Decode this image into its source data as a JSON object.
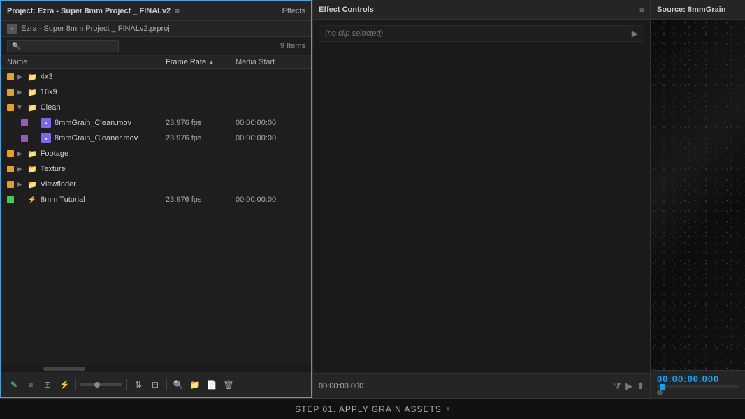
{
  "left_panel": {
    "title": "Project: Ezra - Super 8mm Project _ FINALv2",
    "menu_icon": "≡",
    "tabs": [
      {
        "label": "Effects",
        "active": false
      }
    ],
    "project_path": "Ezra - Super 8mm Project _ FINALv2.prproj",
    "search_placeholder": "",
    "items_count": "9 Items",
    "columns": {
      "name": "Name",
      "frame_rate": "Frame Rate",
      "media_start": "Media Start"
    },
    "items": [
      {
        "id": "4x3",
        "name": "4x3",
        "type": "folder",
        "color": "orange",
        "indent": 0,
        "expanded": false,
        "fps": "",
        "media_start": ""
      },
      {
        "id": "16x9",
        "name": "16x9",
        "type": "folder",
        "color": "orange",
        "indent": 0,
        "expanded": false,
        "fps": "",
        "media_start": ""
      },
      {
        "id": "clean",
        "name": "Clean",
        "type": "folder",
        "color": "orange",
        "indent": 0,
        "expanded": true,
        "fps": "",
        "media_start": ""
      },
      {
        "id": "8mmgrain_clean",
        "name": "8mmGrain_Clean.mov",
        "type": "file",
        "color": "purple",
        "indent": 1,
        "fps": "23.976 fps",
        "media_start": "00:00:00:00"
      },
      {
        "id": "8mmgrain_cleaner",
        "name": "8mmGrain_Cleaner.mov",
        "type": "file",
        "color": "purple",
        "indent": 1,
        "fps": "23.976 fps",
        "media_start": "00:00:00:00"
      },
      {
        "id": "footage",
        "name": "Footage",
        "type": "folder",
        "color": "orange",
        "indent": 0,
        "expanded": false,
        "fps": "",
        "media_start": ""
      },
      {
        "id": "texture",
        "name": "Texture",
        "type": "folder",
        "color": "orange",
        "indent": 0,
        "expanded": false,
        "fps": "",
        "media_start": ""
      },
      {
        "id": "viewfinder",
        "name": "Viewfinder",
        "type": "folder",
        "color": "orange",
        "indent": 0,
        "expanded": false,
        "fps": "",
        "media_start": ""
      },
      {
        "id": "8mm_tutorial",
        "name": "8mm Tutorial",
        "type": "sequence",
        "color": "green",
        "indent": 0,
        "fps": "23.976 fps",
        "media_start": "00:00:00:00"
      }
    ],
    "toolbar": {
      "new_item": "✎",
      "list_view": "≡",
      "icon_view": "⊞",
      "automate": "⚡",
      "find": "🔍",
      "new_bin": "📁",
      "new_item2": "📄",
      "delete": "🗑"
    }
  },
  "effect_controls": {
    "title": "Effect Controls",
    "menu_icon": "≡",
    "no_clip_text": "(no clip selected)",
    "timecode": "00:00:00.000"
  },
  "source_panel": {
    "title": "Source: 8mmGrain"
  },
  "bottom_bar": {
    "label": "STEP 01. APPLY GRAIN ASSETS",
    "dot": "●"
  }
}
